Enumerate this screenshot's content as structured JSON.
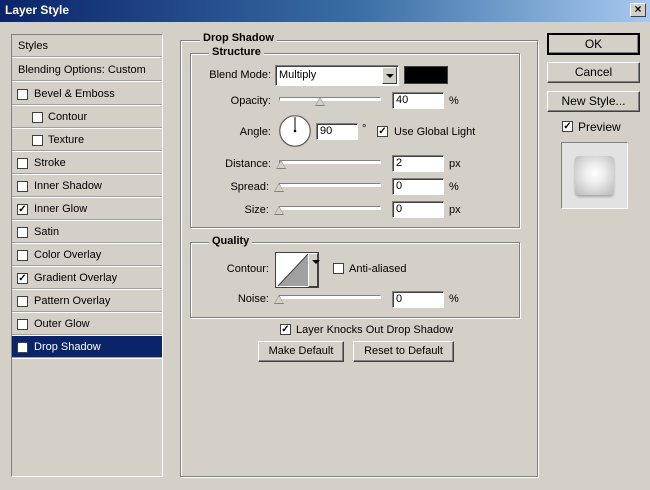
{
  "window": {
    "title": "Layer Style",
    "close_glyph": "×"
  },
  "left_panel": {
    "styles_label": "Styles",
    "blending_label": "Blending Options: Custom",
    "items": [
      {
        "label": "Bevel & Emboss",
        "checked": false,
        "indent": false
      },
      {
        "label": "Contour",
        "checked": false,
        "indent": true
      },
      {
        "label": "Texture",
        "checked": false,
        "indent": true
      },
      {
        "label": "Stroke",
        "checked": false,
        "indent": false
      },
      {
        "label": "Inner Shadow",
        "checked": false,
        "indent": false
      },
      {
        "label": "Inner Glow",
        "checked": true,
        "indent": false
      },
      {
        "label": "Satin",
        "checked": false,
        "indent": false
      },
      {
        "label": "Color Overlay",
        "checked": false,
        "indent": false
      },
      {
        "label": "Gradient Overlay",
        "checked": true,
        "indent": false
      },
      {
        "label": "Pattern Overlay",
        "checked": false,
        "indent": false
      },
      {
        "label": "Outer Glow",
        "checked": false,
        "indent": false
      },
      {
        "label": "Drop Shadow",
        "checked": true,
        "indent": false,
        "selected": true
      }
    ]
  },
  "drop_shadow": {
    "section_title": "Drop Shadow",
    "structure_title": "Structure",
    "blend_mode_label": "Blend Mode:",
    "blend_mode_value": "Multiply",
    "shadow_color": "#000000",
    "opacity_label": "Opacity:",
    "opacity_value": "40",
    "opacity_unit": "%",
    "opacity_fraction": 0.4,
    "angle_label": "Angle:",
    "angle_value": "90",
    "angle_unit": "°",
    "use_global_light_label": "Use Global Light",
    "use_global_light_checked": true,
    "distance_label": "Distance:",
    "distance_value": "2",
    "distance_unit": "px",
    "spread_label": "Spread:",
    "spread_value": "0",
    "spread_unit": "%",
    "size_label": "Size:",
    "size_value": "0",
    "size_unit": "px",
    "quality_title": "Quality",
    "contour_label": "Contour:",
    "anti_aliased_label": "Anti-aliased",
    "anti_aliased_checked": false,
    "noise_label": "Noise:",
    "noise_value": "0",
    "noise_unit": "%",
    "layer_knocks_out_label": "Layer Knocks Out Drop Shadow",
    "layer_knocks_out_checked": true,
    "make_default_label": "Make Default",
    "reset_default_label": "Reset to Default"
  },
  "right_panel": {
    "ok_label": "OK",
    "cancel_label": "Cancel",
    "new_style_label": "New Style...",
    "preview_label": "Preview",
    "preview_checked": true
  },
  "check_glyph": "✓"
}
